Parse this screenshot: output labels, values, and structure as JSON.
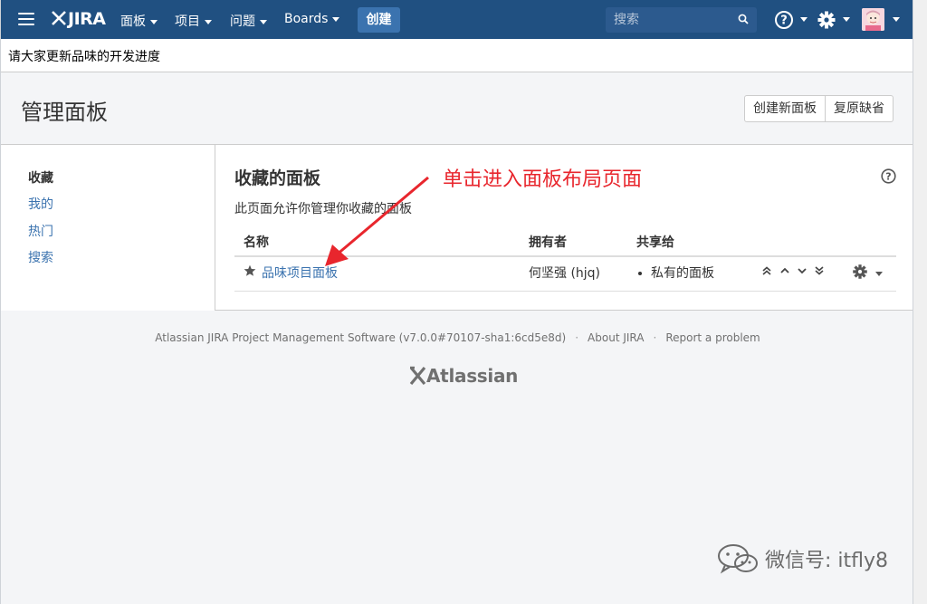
{
  "header": {
    "logo": "JIRA",
    "nav": [
      {
        "label": "面板"
      },
      {
        "label": "项目"
      },
      {
        "label": "问题"
      },
      {
        "label": "Boards"
      }
    ],
    "create_label": "创建",
    "search_placeholder": "搜索",
    "colors": {
      "bar": "#205081",
      "create": "#3b73af"
    }
  },
  "announcement": "请大家更新品味的开发进度",
  "page": {
    "title": "管理面板",
    "buttons": {
      "create_new": "创建新面板",
      "restore_default": "复原缺省"
    }
  },
  "sidebar": {
    "items": [
      {
        "label": "收藏",
        "active": true
      },
      {
        "label": "我的"
      },
      {
        "label": "热门"
      },
      {
        "label": "搜索"
      }
    ]
  },
  "main": {
    "section_title": "收藏的面板",
    "description": "此页面允许你管理你收藏的面板",
    "columns": {
      "name": "名称",
      "owner": "拥有者",
      "shared": "共享给"
    },
    "rows": [
      {
        "name": "品味项目面板",
        "owner": "何坚强 (hjq)",
        "shared": "私有的面板"
      }
    ]
  },
  "annotation": {
    "text": "单击进入面板布局页面",
    "color": "#e8262d"
  },
  "footer": {
    "version": "Atlassian JIRA Project Management Software (v7.0.0#70107-sha1:6cd5e8d)",
    "about": "About JIRA",
    "report": "Report a problem",
    "brand": "Atlassian"
  },
  "watermark": "微信号: itfly8"
}
